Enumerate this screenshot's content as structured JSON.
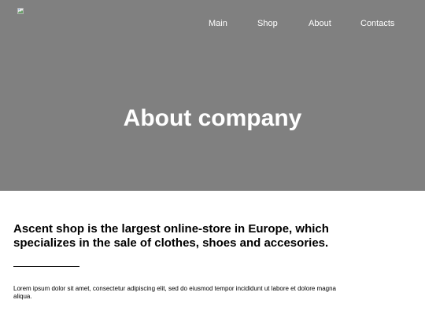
{
  "header": {
    "logo_icon": "broken-image-icon",
    "nav": {
      "main": "Main",
      "shop": "Shop",
      "about": "About",
      "contacts": "Contacts"
    },
    "hero_title": "About company",
    "hero_background": "#808080"
  },
  "content": {
    "headline": "Ascent shop is the largest online-store in Europe, which specializes in the sale of clothes, shoes and accesories.",
    "paragraph": "Lorem ipsum dolor sit amet, consectetur adipiscing elit, sed do eiusmod tempor incididunt ut labore et dolore magna aliqua."
  }
}
